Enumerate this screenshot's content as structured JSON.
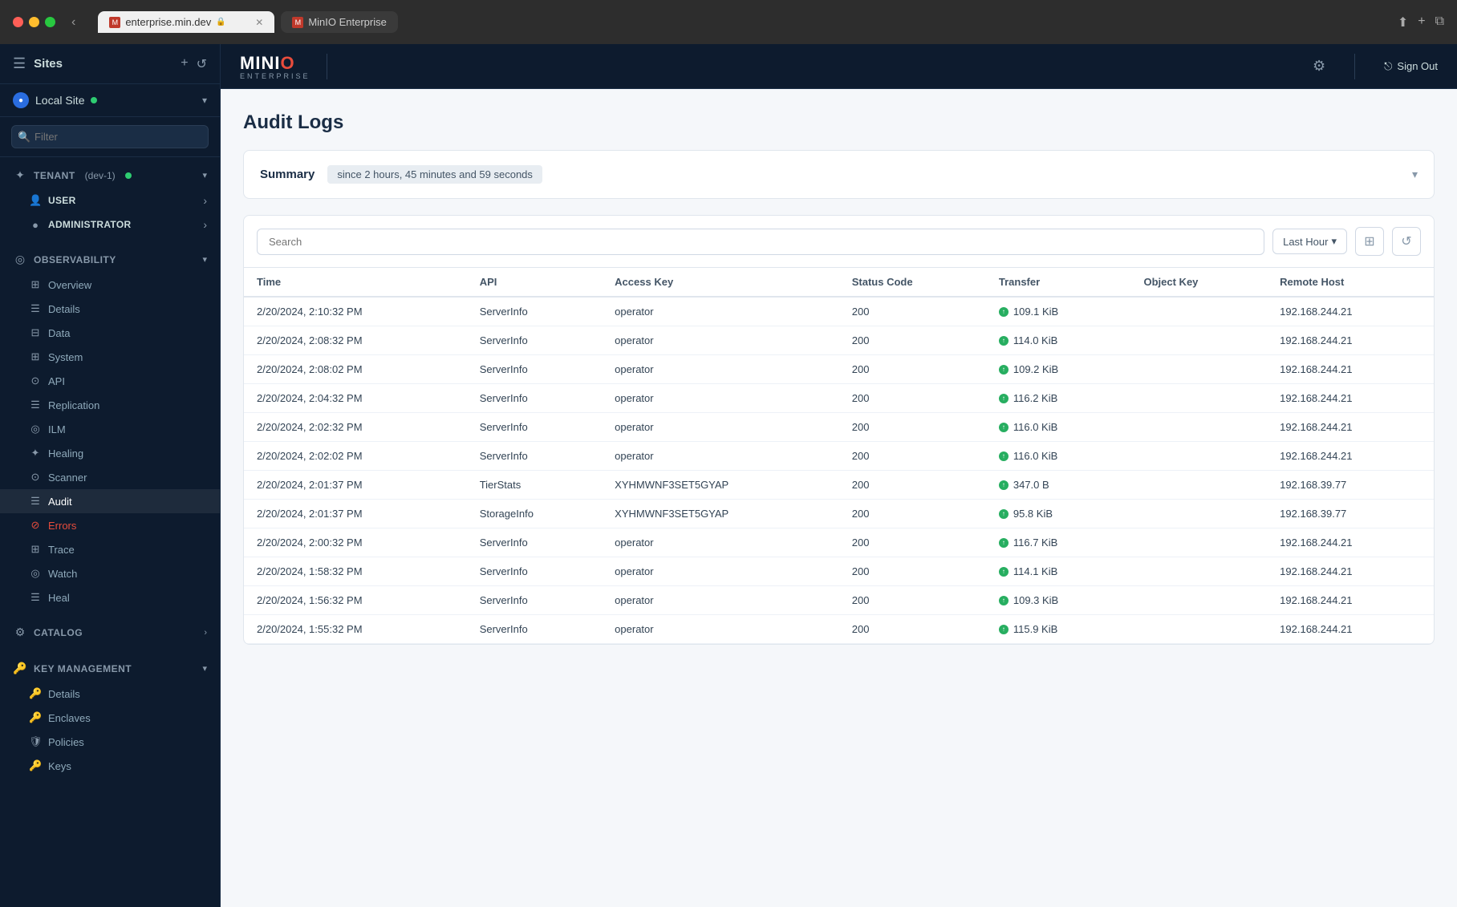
{
  "browser": {
    "tab_active_url": "enterprise.min.dev",
    "tab_active_title": "MinIO Enterprise",
    "tab_lock_icon": "🔒",
    "tab_favicon": "M"
  },
  "header": {
    "logo_main": "MINI",
    "logo_accent": "O",
    "logo_sub": "ENTERPRISE",
    "gear_icon": "⚙",
    "signout_icon": "→",
    "signout_label": "Sign Out",
    "divider": true
  },
  "sidebar": {
    "title": "Sites",
    "add_icon": "+",
    "refresh_icon": "↺",
    "site": {
      "name": "Local Site",
      "active": true,
      "chevron": "▾"
    },
    "filter_placeholder": "Filter",
    "sections": [
      {
        "id": "tenant",
        "label": "TENANT",
        "suffix": "(dev-1)",
        "has_badge": true,
        "chevron": "▾",
        "items": [
          {
            "id": "user",
            "label": "USER",
            "icon": "👤",
            "arrow": "›",
            "bold": true
          },
          {
            "id": "administrator",
            "label": "ADMINISTRATOR",
            "icon": "●",
            "arrow": "›",
            "bold": true
          }
        ]
      },
      {
        "id": "observability",
        "label": "OBSERVABILITY",
        "chevron": "▾",
        "items": [
          {
            "id": "overview",
            "label": "Overview",
            "icon": "⊞"
          },
          {
            "id": "details",
            "label": "Details",
            "icon": "☰"
          },
          {
            "id": "data",
            "label": "Data",
            "icon": "⊟"
          },
          {
            "id": "system",
            "label": "System",
            "icon": "⊞"
          },
          {
            "id": "api",
            "label": "API",
            "icon": "⊙"
          },
          {
            "id": "replication",
            "label": "Replication",
            "icon": "☰"
          },
          {
            "id": "ilm",
            "label": "ILM",
            "icon": "◎"
          },
          {
            "id": "healing",
            "label": "Healing",
            "icon": "✦"
          },
          {
            "id": "scanner",
            "label": "Scanner",
            "icon": "⊙"
          },
          {
            "id": "audit",
            "label": "Audit",
            "icon": "☰",
            "active": true
          },
          {
            "id": "errors",
            "label": "Errors",
            "icon": "⊘",
            "error": true
          },
          {
            "id": "trace",
            "label": "Trace",
            "icon": "⊞"
          },
          {
            "id": "watch",
            "label": "Watch",
            "icon": "◎"
          },
          {
            "id": "heal",
            "label": "Heal",
            "icon": "☰"
          }
        ]
      },
      {
        "id": "catalog",
        "label": "CATALOG",
        "arrow": "›"
      },
      {
        "id": "key-management",
        "label": "KEY MANAGEMENT",
        "chevron": "▾",
        "items": [
          {
            "id": "km-details",
            "label": "Details",
            "icon": "🔑"
          },
          {
            "id": "enclaves",
            "label": "Enclaves",
            "icon": "🔑"
          },
          {
            "id": "policies",
            "label": "Policies",
            "icon": "🛡"
          },
          {
            "id": "keys",
            "label": "Keys",
            "icon": "🔑"
          }
        ]
      }
    ]
  },
  "main": {
    "page_title": "Audit Logs",
    "summary": {
      "title": "Summary",
      "badge": "since 2 hours, 45 minutes and 59 seconds",
      "chevron": "▾"
    },
    "search_placeholder": "Search",
    "time_filter": "Last Hour",
    "time_chevron": "▾",
    "filter_icon": "⊞",
    "refresh_icon": "↺",
    "table": {
      "columns": [
        "Time",
        "API",
        "Access Key",
        "Status Code",
        "Transfer",
        "Object Key",
        "Remote Host"
      ],
      "rows": [
        {
          "time": "2/20/2024, 2:10:32 PM",
          "api": "ServerInfo",
          "access_key": "operator",
          "status": "200",
          "transfer": "109.1 KiB",
          "object_key": "",
          "remote_host": "192.168.244.21"
        },
        {
          "time": "2/20/2024, 2:08:32 PM",
          "api": "ServerInfo",
          "access_key": "operator",
          "status": "200",
          "transfer": "114.0 KiB",
          "object_key": "",
          "remote_host": "192.168.244.21"
        },
        {
          "time": "2/20/2024, 2:08:02 PM",
          "api": "ServerInfo",
          "access_key": "operator",
          "status": "200",
          "transfer": "109.2 KiB",
          "object_key": "",
          "remote_host": "192.168.244.21"
        },
        {
          "time": "2/20/2024, 2:04:32 PM",
          "api": "ServerInfo",
          "access_key": "operator",
          "status": "200",
          "transfer": "116.2 KiB",
          "object_key": "",
          "remote_host": "192.168.244.21"
        },
        {
          "time": "2/20/2024, 2:02:32 PM",
          "api": "ServerInfo",
          "access_key": "operator",
          "status": "200",
          "transfer": "116.0 KiB",
          "object_key": "",
          "remote_host": "192.168.244.21"
        },
        {
          "time": "2/20/2024, 2:02:02 PM",
          "api": "ServerInfo",
          "access_key": "operator",
          "status": "200",
          "transfer": "116.0 KiB",
          "object_key": "",
          "remote_host": "192.168.244.21"
        },
        {
          "time": "2/20/2024, 2:01:37 PM",
          "api": "TierStats",
          "access_key": "XYHMWNF3SET5GYAP",
          "status": "200",
          "transfer": "347.0 B",
          "object_key": "",
          "remote_host": "192.168.39.77"
        },
        {
          "time": "2/20/2024, 2:01:37 PM",
          "api": "StorageInfo",
          "access_key": "XYHMWNF3SET5GYAP",
          "status": "200",
          "transfer": "95.8 KiB",
          "object_key": "",
          "remote_host": "192.168.39.77"
        },
        {
          "time": "2/20/2024, 2:00:32 PM",
          "api": "ServerInfo",
          "access_key": "operator",
          "status": "200",
          "transfer": "116.7 KiB",
          "object_key": "",
          "remote_host": "192.168.244.21"
        },
        {
          "time": "2/20/2024, 1:58:32 PM",
          "api": "ServerInfo",
          "access_key": "operator",
          "status": "200",
          "transfer": "114.1 KiB",
          "object_key": "",
          "remote_host": "192.168.244.21"
        },
        {
          "time": "2/20/2024, 1:56:32 PM",
          "api": "ServerInfo",
          "access_key": "operator",
          "status": "200",
          "transfer": "109.3 KiB",
          "object_key": "",
          "remote_host": "192.168.244.21"
        },
        {
          "time": "2/20/2024, 1:55:32 PM",
          "api": "ServerInfo",
          "access_key": "operator",
          "status": "200",
          "transfer": "115.9 KiB",
          "object_key": "",
          "remote_host": "192.168.244.21"
        }
      ]
    }
  }
}
